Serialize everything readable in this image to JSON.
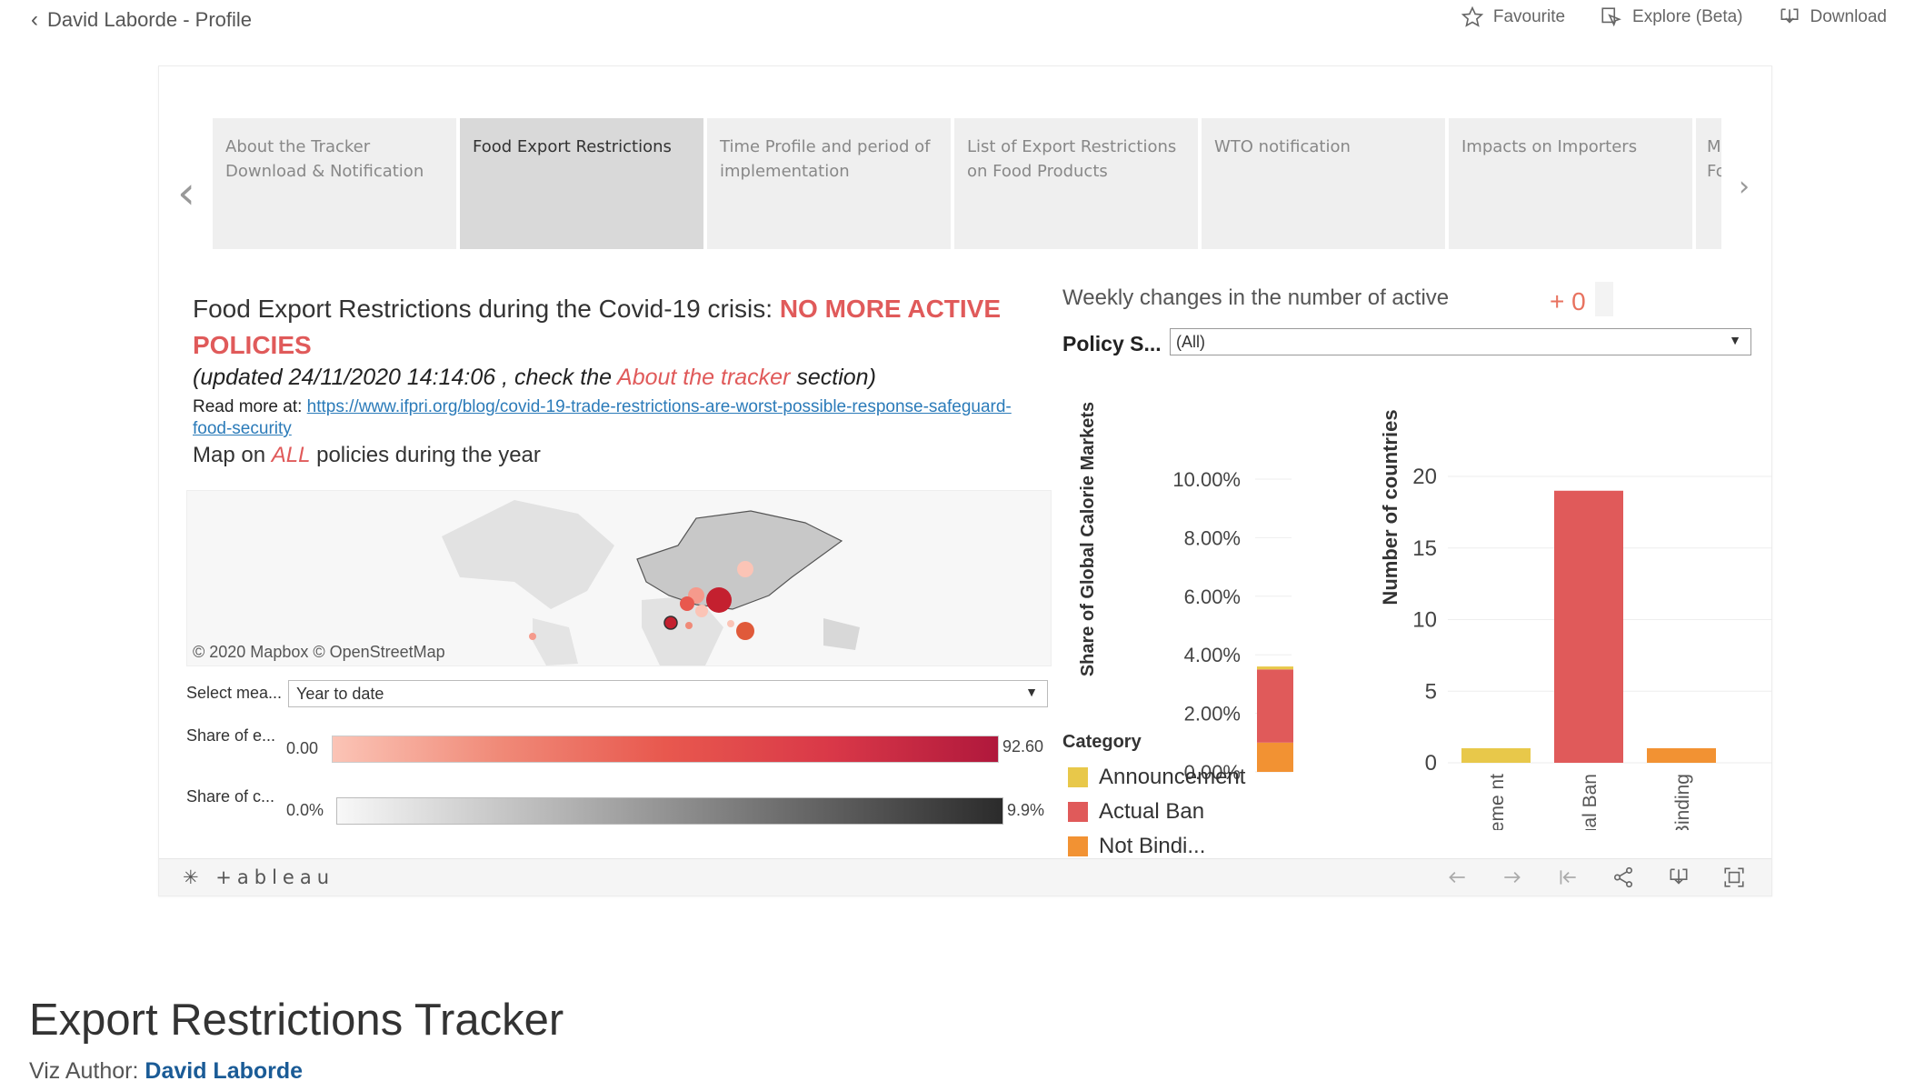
{
  "topbar": {
    "back_label": "David Laborde - Profile",
    "favourite_label": "Favourite",
    "explore_label": "Explore (Beta)",
    "download_label": "Download"
  },
  "tabs": [
    {
      "label": "About the Tracker Download & Notification"
    },
    {
      "label": "Food Export Restrictions"
    },
    {
      "label": "Time Profile and period of implementation"
    },
    {
      "label": "List of Export Restrictions on Food Products"
    },
    {
      "label": "WTO notification"
    },
    {
      "label": "Impacts on Importers"
    },
    {
      "label": "M Fo"
    }
  ],
  "dashboard": {
    "title_main": "Food Export Restrictions during the Covid-19 crisis: ",
    "title_highlight": "NO MORE ACTIVE POLICIES",
    "updated_prefix": "(updated 24/11/2020 14:14:06 , check the ",
    "updated_link": "About the tracker",
    "updated_suffix": " section)",
    "readmore_label": "Read more at: ",
    "readmore_url": "https://www.ifpri.org/blog/covid-19-trade-restrictions-are-worst-possible-response-safeguard-food-security",
    "map_prefix": "Map on ",
    "map_highlight": "ALL",
    "map_suffix": "  policies during the year",
    "map_attribution": "© 2020 Mapbox  © OpenStreetMap",
    "select_label": "Select mea...",
    "select_value": "Year to date",
    "legend1_label": "Share of e...",
    "legend1_min": "0.00",
    "legend1_max": "92.60",
    "legend2_label": "Share of c...",
    "legend2_min": "0.0%",
    "legend2_max": "9.9%"
  },
  "right_panel": {
    "weekly_label": "Weekly changes in the number of active",
    "weekly_value": "+ 0",
    "policy_label": "Policy S...",
    "policy_value": "(All)",
    "category_title": "Category",
    "categories": [
      {
        "name": "Announcement",
        "color": "#e8c84a"
      },
      {
        "name": "Actual Ban",
        "color": "#e05a5a"
      },
      {
        "name": "Not Bindi...",
        "color": "#f29233"
      }
    ]
  },
  "chart_data": [
    {
      "type": "bar",
      "ylabel": "Share of Global Calorie Markets",
      "ylim": [
        0,
        10
      ],
      "y_ticks": [
        "0.00%",
        "2.00%",
        "4.00%",
        "6.00%",
        "8.00%",
        "10.00%"
      ],
      "y_tick_values": [
        0,
        2,
        4,
        6,
        8,
        10
      ],
      "stacked": true,
      "series": [
        {
          "name": "Not Binding",
          "values": [
            1.0
          ],
          "color": "#f29233"
        },
        {
          "name": "Actual Ban",
          "values": [
            2.5
          ],
          "color": "#e05a5a"
        },
        {
          "name": "Announcement",
          "values": [
            0.1
          ],
          "color": "#e8c84a"
        }
      ]
    },
    {
      "type": "bar",
      "ylabel": "Number of countries",
      "ylim": [
        0,
        20
      ],
      "y_ticks": [
        "0",
        "5",
        "10",
        "15",
        "20"
      ],
      "y_tick_values": [
        0,
        5,
        10,
        15,
        20
      ],
      "categories": [
        "Announceme nt",
        "Actual Ban",
        "Not Binding"
      ],
      "values": [
        0.3,
        19,
        0.3
      ],
      "colors": [
        "#e8c84a",
        "#e05a5a",
        "#f29233"
      ]
    }
  ],
  "toolbar": {
    "logo": "+ableau"
  },
  "viz": {
    "title": "Export Restrictions Tracker",
    "author_label": "Viz Author: ",
    "author_name": "David Laborde"
  }
}
